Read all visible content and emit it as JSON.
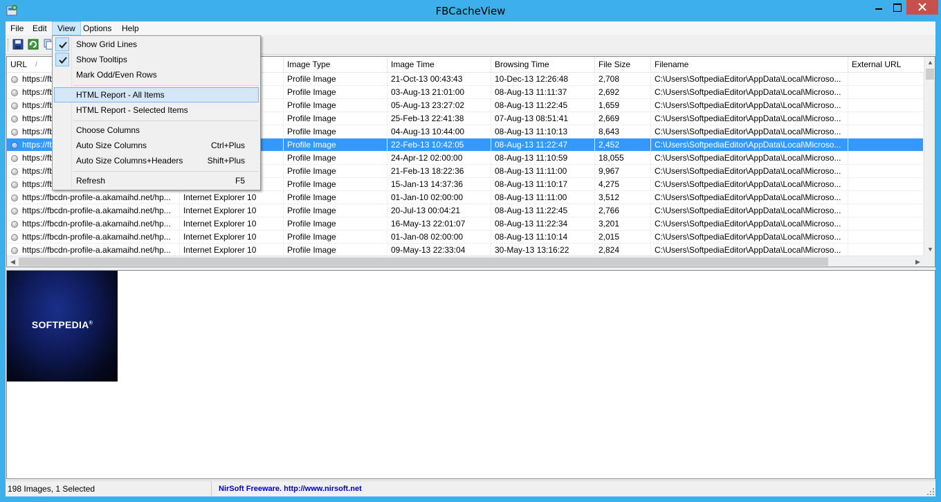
{
  "window": {
    "title": "FBCacheView"
  },
  "menubar": {
    "items": [
      "File",
      "Edit",
      "View",
      "Options",
      "Help"
    ]
  },
  "toolbar": {
    "buttons": [
      "save-icon",
      "refresh-icon",
      "copy-icon"
    ]
  },
  "view_menu": {
    "items": [
      {
        "label": "Show Grid Lines",
        "shortcut": "",
        "checked": true
      },
      {
        "label": "Show Tooltips",
        "shortcut": "",
        "checked": true
      },
      {
        "label": "Mark Odd/Even Rows",
        "shortcut": "",
        "checked": false
      },
      {
        "label": "HTML Report - All Items",
        "shortcut": "",
        "checked": false,
        "highlighted": true
      },
      {
        "label": "HTML Report - Selected Items",
        "shortcut": "",
        "checked": false
      },
      {
        "label": "Choose Columns",
        "shortcut": "",
        "checked": false
      },
      {
        "label": "Auto Size Columns",
        "shortcut": "Ctrl+Plus",
        "checked": false
      },
      {
        "label": "Auto Size Columns+Headers",
        "shortcut": "Shift+Plus",
        "checked": false
      },
      {
        "label": "Refresh",
        "shortcut": "F5",
        "checked": false
      }
    ]
  },
  "table": {
    "columns": [
      "URL",
      "",
      "Image Type",
      "Image Time",
      "Browsing Time",
      "File Size",
      "Filename",
      "External URL"
    ],
    "sort_indicator": "/",
    "selected_row": 5,
    "rows": [
      [
        "https://fb",
        "",
        "Profile Image",
        "21-Oct-13 00:43:43",
        "10-Dec-13 12:26:48",
        "2,708",
        "C:\\Users\\SoftpediaEditor\\AppData\\Local\\Microso...",
        ""
      ],
      [
        "https://fb",
        "",
        "Profile Image",
        "03-Aug-13 21:01:00",
        "08-Aug-13 11:11:37",
        "2,692",
        "C:\\Users\\SoftpediaEditor\\AppData\\Local\\Microso...",
        ""
      ],
      [
        "https://fb",
        "",
        "Profile Image",
        "05-Aug-13 23:27:02",
        "08-Aug-13 11:22:45",
        "1,659",
        "C:\\Users\\SoftpediaEditor\\AppData\\Local\\Microso...",
        ""
      ],
      [
        "https://fb",
        "",
        "Profile Image",
        "25-Feb-13 22:41:38",
        "07-Aug-13 08:51:41",
        "2,669",
        "C:\\Users\\SoftpediaEditor\\AppData\\Local\\Microso...",
        ""
      ],
      [
        "https://fb",
        "",
        "Profile Image",
        "04-Aug-13 10:44:00",
        "08-Aug-13 11:10:13",
        "8,643",
        "C:\\Users\\SoftpediaEditor\\AppData\\Local\\Microso...",
        ""
      ],
      [
        "https://fb",
        "",
        "Profile Image",
        "22-Feb-13 10:42:05",
        "08-Aug-13 11:22:47",
        "2,452",
        "C:\\Users\\SoftpediaEditor\\AppData\\Local\\Microso...",
        ""
      ],
      [
        "https://fb",
        "",
        "Profile Image",
        "24-Apr-12 02:00:00",
        "08-Aug-13 11:10:59",
        "18,055",
        "C:\\Users\\SoftpediaEditor\\AppData\\Local\\Microso...",
        ""
      ],
      [
        "https://fb",
        "",
        "Profile Image",
        "21-Feb-13 18:22:36",
        "08-Aug-13 11:11:00",
        "9,967",
        "C:\\Users\\SoftpediaEditor\\AppData\\Local\\Microso...",
        ""
      ],
      [
        "https://fb",
        "",
        "Profile Image",
        "15-Jan-13 14:37:36",
        "08-Aug-13 11:10:17",
        "4,275",
        "C:\\Users\\SoftpediaEditor\\AppData\\Local\\Microso...",
        ""
      ],
      [
        "https://fbcdn-profile-a.akamaihd.net/hp...",
        "Internet Explorer 10",
        "Profile Image",
        "01-Jan-10 02:00:00",
        "08-Aug-13 11:11:00",
        "3,512",
        "C:\\Users\\SoftpediaEditor\\AppData\\Local\\Microso...",
        ""
      ],
      [
        "https://fbcdn-profile-a.akamaihd.net/hp...",
        "Internet Explorer 10",
        "Profile Image",
        "20-Jul-13 00:04:21",
        "08-Aug-13 11:22:45",
        "2,766",
        "C:\\Users\\SoftpediaEditor\\AppData\\Local\\Microso...",
        ""
      ],
      [
        "https://fbcdn-profile-a.akamaihd.net/hp...",
        "Internet Explorer 10",
        "Profile Image",
        "16-May-13 22:01:07",
        "08-Aug-13 11:22:34",
        "3,201",
        "C:\\Users\\SoftpediaEditor\\AppData\\Local\\Microso...",
        ""
      ],
      [
        "https://fbcdn-profile-a.akamaihd.net/hp...",
        "Internet Explorer 10",
        "Profile Image",
        "01-Jan-08 02:00:00",
        "08-Aug-13 11:10:14",
        "2,015",
        "C:\\Users\\SoftpediaEditor\\AppData\\Local\\Microso...",
        ""
      ],
      [
        "https://fbcdn-profile-a.akamaihd.net/hp...",
        "Internet Explorer 10",
        "Profile Image",
        "09-May-13 22:33:04",
        "30-May-13 13:16:22",
        "2,824",
        "C:\\Users\\SoftpediaEditor\\AppData\\Local\\Microso...",
        ""
      ]
    ]
  },
  "preview": {
    "image_text": "SOFTPEDIA",
    "image_mark": "®"
  },
  "statusbar": {
    "count": "198 Images, 1 Selected",
    "credit": "NirSoft Freeware.  http://www.nirsoft.net"
  },
  "colors": {
    "title_bar": "#3dafea",
    "selection": "#3399ff",
    "close_button": "#c7504b",
    "link": "#0000c8"
  }
}
